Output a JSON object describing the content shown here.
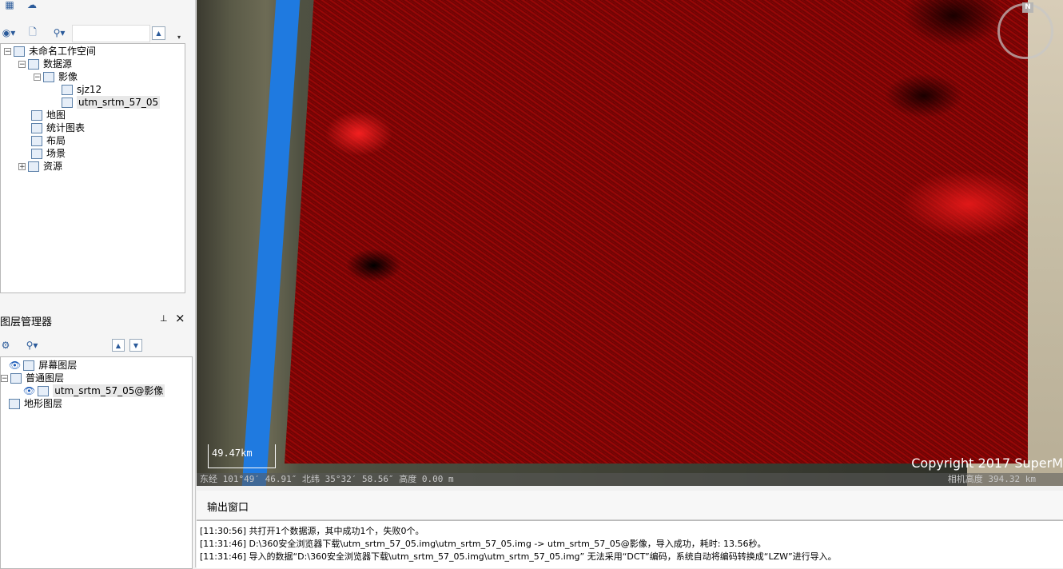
{
  "workspace": {
    "nodes": [
      {
        "label": "未命名工作空间",
        "icon": "workspace-icon"
      },
      {
        "label": "数据源",
        "icon": "datasource-icon"
      },
      {
        "label": "影像",
        "icon": "image-folder-icon"
      },
      {
        "label": "sjz12",
        "icon": "raster-icon"
      },
      {
        "label": "utm_srtm_57_05",
        "icon": "raster-icon"
      },
      {
        "label": "地图",
        "icon": "map-icon"
      },
      {
        "label": "统计图表",
        "icon": "chart-icon"
      },
      {
        "label": "布局",
        "icon": "layout-icon"
      },
      {
        "label": "场景",
        "icon": "scene-icon"
      },
      {
        "label": "资源",
        "icon": "resource-icon"
      }
    ],
    "expanders": [
      "−",
      "−",
      "−",
      "+"
    ]
  },
  "layer_panel": {
    "title": "图层管理器",
    "pin": "⊥",
    "close": "×",
    "layers": [
      {
        "label": "屏幕图层"
      },
      {
        "label": "普通图层"
      },
      {
        "label": "utm_srtm_57_05@影像"
      },
      {
        "label": "地形图层"
      }
    ]
  },
  "scene": {
    "compass_label": "N",
    "scale_label": "49.47km",
    "copyright": "Copyright 2017 SuperM",
    "status_left": "东经 101°49′ 46.91″  北纬 35°32′ 58.56″  高度 0.00 m",
    "status_right": "相机高度 394.32 km",
    "colors": {
      "terrain": "#8a0606",
      "edge": "#1f7ae0"
    }
  },
  "output": {
    "tab": "输出窗口",
    "lines": [
      "[11:30:56] 共打开1个数据源，其中成功1个，失败0个。",
      "[11:31:46] D:\\360安全浏览器下载\\utm_srtm_57_05.img\\utm_srtm_57_05.img     -> utm_srtm_57_05@影像，导入成功，耗时: 13.56秒。",
      "[11:31:46] 导入的数据“D:\\360安全浏览器下载\\utm_srtm_57_05.img\\utm_srtm_57_05.img” 无法采用“DCT”编码，系统自动将编码转换成“LZW”进行导入。"
    ]
  }
}
